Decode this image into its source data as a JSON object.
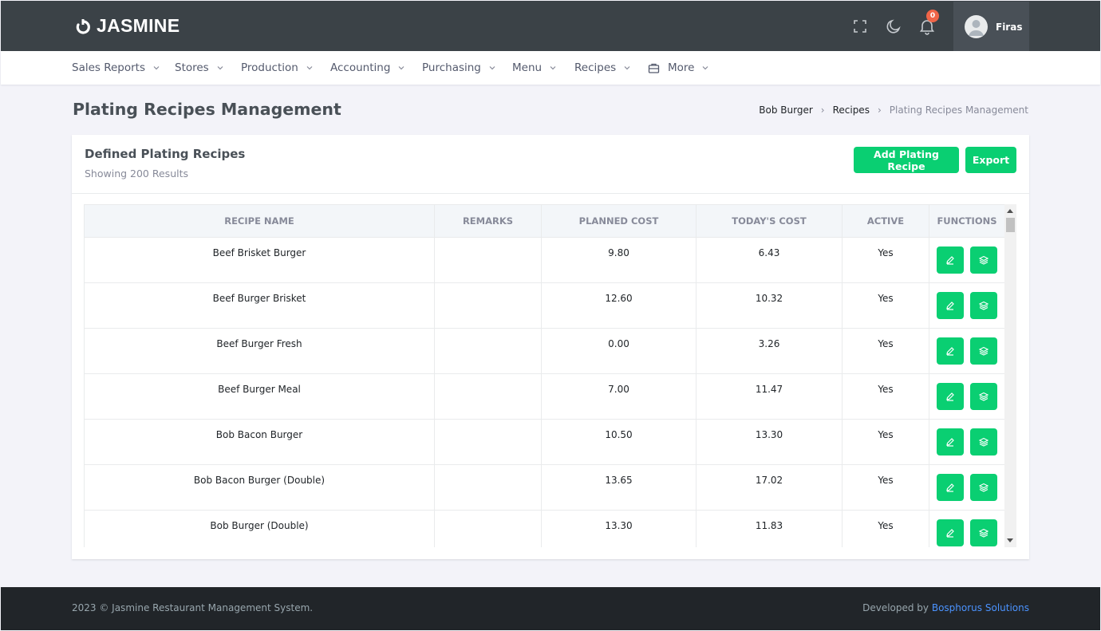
{
  "app": {
    "name": "JASMINE"
  },
  "topbar": {
    "notification_count": "0",
    "user_name": "Firas"
  },
  "nav": {
    "items": [
      {
        "label": "Sales Reports"
      },
      {
        "label": "Stores"
      },
      {
        "label": "Production"
      },
      {
        "label": "Accounting"
      },
      {
        "label": "Purchasing"
      },
      {
        "label": "Menu"
      },
      {
        "label": "Recipes"
      },
      {
        "label": "More"
      }
    ]
  },
  "page": {
    "title": "Plating Recipes Management",
    "breadcrumb": [
      "Bob Burger",
      "Recipes",
      "Plating Recipes Management"
    ]
  },
  "card": {
    "title": "Defined Plating Recipes",
    "subtitle": "Showing 200 Results",
    "add_label": "Add Plating Recipe",
    "export_label": "Export"
  },
  "table": {
    "headers": [
      "RECIPE NAME",
      "REMARKS",
      "PLANNED COST",
      "TODAY'S COST",
      "ACTIVE",
      "FUNCTIONS"
    ],
    "rows": [
      {
        "name": "Beef Brisket Burger",
        "remarks": "",
        "planned": "9.80",
        "today": "6.43",
        "active": "Yes"
      },
      {
        "name": "Beef Burger Brisket",
        "remarks": "",
        "planned": "12.60",
        "today": "10.32",
        "active": "Yes"
      },
      {
        "name": "Beef Burger Fresh",
        "remarks": "",
        "planned": "0.00",
        "today": "3.26",
        "active": "Yes"
      },
      {
        "name": "Beef Burger Meal",
        "remarks": "",
        "planned": "7.00",
        "today": "11.47",
        "active": "Yes"
      },
      {
        "name": "Bob Bacon Burger",
        "remarks": "",
        "planned": "10.50",
        "today": "13.30",
        "active": "Yes"
      },
      {
        "name": "Bob Bacon Burger (Double)",
        "remarks": "",
        "planned": "13.65",
        "today": "17.02",
        "active": "Yes"
      },
      {
        "name": "Bob Burger (Double)",
        "remarks": "",
        "planned": "13.30",
        "today": "11.83",
        "active": "Yes"
      }
    ]
  },
  "footer": {
    "copyright": "2023 © Jasmine Restaurant Management System.",
    "developed_by": "Developed by",
    "developer": "Bosphorus Solutions"
  },
  "colors": {
    "topbar": "#3b4247",
    "accent_green": "#0acf72",
    "badge_red": "#f06548",
    "footer": "#212529",
    "link_blue": "#4b93ff"
  }
}
